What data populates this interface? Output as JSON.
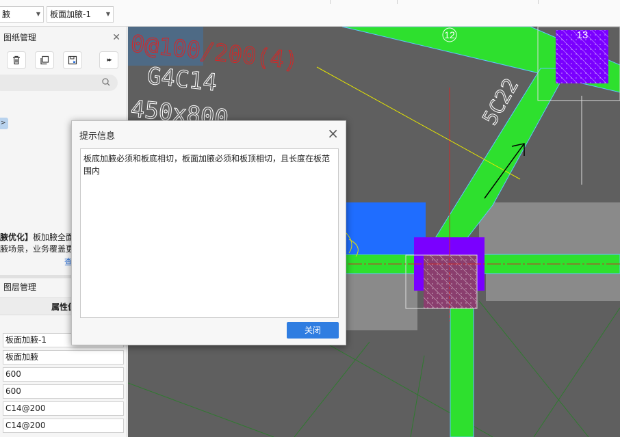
{
  "toolbar": {
    "combo1_value": "腋",
    "combo2_value": "板面加腋-1"
  },
  "drawing_panel": {
    "title": "图纸管理",
    "search_placeholder": ""
  },
  "news": {
    "line1_bold": "腋优化】",
    "line1_rest": "板加腋全面",
    "line2": "腋场景，业务覆盖更",
    "link": "查"
  },
  "layer_panel": {
    "title": "图层管理",
    "column_header": "属性值"
  },
  "properties": [
    "板面加腋-1",
    "板面加腋",
    "600",
    "600",
    "C14@200",
    "C14@200"
  ],
  "canvas": {
    "axis_12": "12",
    "axis_13": "13",
    "annotations": [
      "0@100/200(4)",
      "G4C14",
      "450x800",
      "5C22"
    ]
  },
  "dialog": {
    "title": "提示信息",
    "message": "板底加腋必须和板底相切，板面加腋必须和板顶相切，且长度在板范围内",
    "ok_label": "关闭"
  },
  "colors": {
    "accent_button": "#2f7de1",
    "beam_green": "#2ee02e",
    "column_purple": "#7a00ff",
    "canvas_bg": "#5f5f5f"
  }
}
